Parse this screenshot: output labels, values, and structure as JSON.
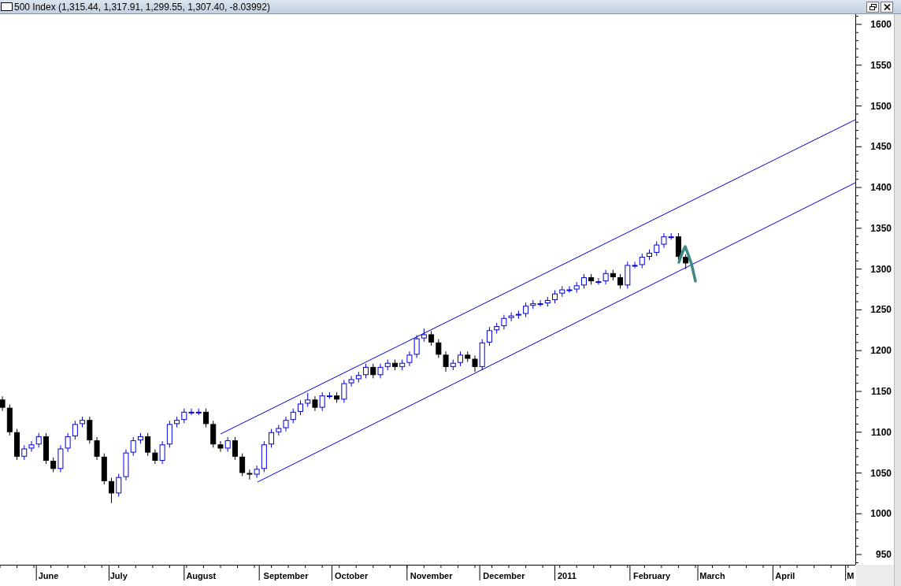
{
  "window": {
    "title": "500 Index (1,315.44, 1,317.91, 1,299.55, 1,307.40, -8.03992)"
  },
  "chart": {
    "chart_data": {
      "type": "candlestick",
      "x": [
        "2010-05-18",
        "2010-05-21",
        "2010-05-24",
        "2010-05-27",
        "2010-05-30",
        "2010-06-02",
        "2010-06-05",
        "2010-06-08",
        "2010-06-11",
        "2010-06-14",
        "2010-06-17",
        "2010-06-20",
        "2010-06-23",
        "2010-06-26",
        "2010-06-29",
        "2010-07-02",
        "2010-07-05",
        "2010-07-08",
        "2010-07-11",
        "2010-07-14",
        "2010-07-17",
        "2010-07-20",
        "2010-07-23",
        "2010-07-26",
        "2010-07-29",
        "2010-08-01",
        "2010-08-04",
        "2010-08-07",
        "2010-08-10",
        "2010-08-13",
        "2010-08-16",
        "2010-08-19",
        "2010-08-22",
        "2010-08-25",
        "2010-08-28",
        "2010-08-31",
        "2010-09-03",
        "2010-09-06",
        "2010-09-09",
        "2010-09-12",
        "2010-09-15",
        "2010-09-18",
        "2010-09-21",
        "2010-09-24",
        "2010-09-27",
        "2010-09-30",
        "2010-10-03",
        "2010-10-06",
        "2010-10-09",
        "2010-10-12",
        "2010-10-15",
        "2010-10-18",
        "2010-10-21",
        "2010-10-24",
        "2010-10-27",
        "2010-10-30",
        "2010-11-02",
        "2010-11-05",
        "2010-11-08",
        "2010-11-11",
        "2010-11-14",
        "2010-11-17",
        "2010-11-20",
        "2010-11-23",
        "2010-11-26",
        "2010-11-29",
        "2010-12-02",
        "2010-12-05",
        "2010-12-08",
        "2010-12-11",
        "2010-12-14",
        "2010-12-17",
        "2010-12-20",
        "2010-12-23",
        "2010-12-26",
        "2010-12-29",
        "2011-01-01",
        "2011-01-04",
        "2011-01-07",
        "2011-01-10",
        "2011-01-13",
        "2011-01-16",
        "2011-01-19",
        "2011-01-22",
        "2011-01-25",
        "2011-01-28",
        "2011-01-31",
        "2011-02-03",
        "2011-02-06",
        "2011-02-09",
        "2011-02-12",
        "2011-02-15",
        "2011-02-18",
        "2011-02-21",
        "2011-02-24"
      ],
      "ohlc": [
        [
          1140,
          1144,
          1126,
          1130
        ],
        [
          1130,
          1134,
          1096,
          1100
        ],
        [
          1100,
          1104,
          1066,
          1070
        ],
        [
          1070,
          1084,
          1066,
          1080
        ],
        [
          1080,
          1089,
          1076,
          1085
        ],
        [
          1085,
          1099,
          1081,
          1095
        ],
        [
          1095,
          1099,
          1061,
          1065
        ],
        [
          1065,
          1069,
          1051,
          1055
        ],
        [
          1055,
          1084,
          1051,
          1080
        ],
        [
          1080,
          1099,
          1076,
          1095
        ],
        [
          1095,
          1114,
          1091,
          1110
        ],
        [
          1110,
          1119,
          1106,
          1115
        ],
        [
          1115,
          1119,
          1086,
          1090
        ],
        [
          1090,
          1094,
          1066,
          1070
        ],
        [
          1070,
          1074,
          1036,
          1040
        ],
        [
          1040,
          1044,
          1013,
          1025
        ],
        [
          1025,
          1049,
          1021,
          1045
        ],
        [
          1045,
          1079,
          1041,
          1075
        ],
        [
          1075,
          1094,
          1071,
          1090
        ],
        [
          1090,
          1099,
          1086,
          1095
        ],
        [
          1095,
          1099,
          1071,
          1075
        ],
        [
          1075,
          1079,
          1061,
          1065
        ],
        [
          1065,
          1089,
          1061,
          1085
        ],
        [
          1085,
          1114,
          1081,
          1110
        ],
        [
          1110,
          1119,
          1106,
          1115
        ],
        [
          1115,
          1129,
          1111,
          1125
        ],
        [
          1125,
          1129,
          1121,
          1125
        ],
        [
          1125,
          1129,
          1121,
          1125
        ],
        [
          1125,
          1129,
          1106,
          1110
        ],
        [
          1110,
          1114,
          1081,
          1085
        ],
        [
          1085,
          1089,
          1076,
          1080
        ],
        [
          1080,
          1094,
          1076,
          1090
        ],
        [
          1090,
          1094,
          1066,
          1070
        ],
        [
          1070,
          1074,
          1046,
          1050
        ],
        [
          1050,
          1054,
          1042,
          1048
        ],
        [
          1048,
          1059,
          1044,
          1055
        ],
        [
          1055,
          1089,
          1051,
          1085
        ],
        [
          1085,
          1104,
          1081,
          1100
        ],
        [
          1100,
          1109,
          1096,
          1105
        ],
        [
          1105,
          1119,
          1101,
          1115
        ],
        [
          1115,
          1129,
          1111,
          1125
        ],
        [
          1125,
          1139,
          1121,
          1135
        ],
        [
          1135,
          1148,
          1131,
          1140
        ],
        [
          1140,
          1144,
          1126,
          1130
        ],
        [
          1130,
          1149,
          1126,
          1145
        ],
        [
          1145,
          1149,
          1141,
          1145
        ],
        [
          1145,
          1149,
          1136,
          1140
        ],
        [
          1140,
          1164,
          1136,
          1160
        ],
        [
          1160,
          1169,
          1156,
          1165
        ],
        [
          1165,
          1174,
          1161,
          1170
        ],
        [
          1170,
          1184,
          1166,
          1180
        ],
        [
          1180,
          1184,
          1166,
          1170
        ],
        [
          1170,
          1184,
          1166,
          1180
        ],
        [
          1180,
          1189,
          1176,
          1185
        ],
        [
          1185,
          1189,
          1176,
          1180
        ],
        [
          1180,
          1189,
          1176,
          1185
        ],
        [
          1185,
          1199,
          1181,
          1195
        ],
        [
          1195,
          1219,
          1191,
          1215
        ],
        [
          1215,
          1227,
          1211,
          1220
        ],
        [
          1220,
          1224,
          1206,
          1210
        ],
        [
          1210,
          1214,
          1191,
          1195
        ],
        [
          1195,
          1199,
          1174,
          1180
        ],
        [
          1180,
          1189,
          1176,
          1185
        ],
        [
          1185,
          1199,
          1181,
          1195
        ],
        [
          1195,
          1199,
          1186,
          1190
        ],
        [
          1190,
          1194,
          1174,
          1180
        ],
        [
          1180,
          1214,
          1176,
          1210
        ],
        [
          1210,
          1229,
          1206,
          1225
        ],
        [
          1225,
          1234,
          1221,
          1230
        ],
        [
          1230,
          1244,
          1226,
          1240
        ],
        [
          1240,
          1247,
          1236,
          1243
        ],
        [
          1243,
          1249,
          1239,
          1245
        ],
        [
          1245,
          1259,
          1241,
          1255
        ],
        [
          1255,
          1262,
          1251,
          1258
        ],
        [
          1258,
          1262,
          1254,
          1258
        ],
        [
          1258,
          1266,
          1254,
          1262
        ],
        [
          1262,
          1274,
          1258,
          1270
        ],
        [
          1270,
          1279,
          1266,
          1275
        ],
        [
          1275,
          1279,
          1271,
          1275
        ],
        [
          1275,
          1284,
          1271,
          1280
        ],
        [
          1280,
          1294,
          1276,
          1290
        ],
        [
          1290,
          1294,
          1281,
          1285
        ],
        [
          1285,
          1289,
          1281,
          1285
        ],
        [
          1285,
          1299,
          1281,
          1295
        ],
        [
          1295,
          1299,
          1286,
          1290
        ],
        [
          1290,
          1294,
          1276,
          1280
        ],
        [
          1280,
          1309,
          1276,
          1305
        ],
        [
          1305,
          1309,
          1301,
          1305
        ],
        [
          1305,
          1319,
          1301,
          1315
        ],
        [
          1315,
          1324,
          1311,
          1320
        ],
        [
          1320,
          1334,
          1316,
          1330
        ],
        [
          1330,
          1344,
          1326,
          1340
        ],
        [
          1340,
          1344,
          1336,
          1340
        ],
        [
          1340,
          1344,
          1311,
          1315
        ],
        [
          1315,
          1318,
          1300,
          1307
        ]
      ],
      "xlim": [
        "2010-05-17",
        "2011-05-05"
      ],
      "ylim": [
        937.5,
        1612.5
      ],
      "yticks": [
        950,
        1000,
        1050,
        1100,
        1150,
        1200,
        1250,
        1300,
        1350,
        1400,
        1450,
        1500,
        1550,
        1600
      ],
      "xticks": [
        {
          "value": "2010-06-06",
          "label": "June"
        },
        {
          "value": "2010-07-05",
          "label": "July"
        },
        {
          "value": "2010-08-08",
          "label": "August"
        },
        {
          "value": "2010-09-12",
          "label": "September"
        },
        {
          "value": "2010-10-09",
          "label": "October"
        },
        {
          "value": "2010-11-11",
          "label": "November"
        },
        {
          "value": "2010-12-11",
          "label": "December"
        },
        {
          "value": "2011-01-06",
          "label": "2011"
        },
        {
          "value": "2011-02-10",
          "label": "February"
        },
        {
          "value": "2011-03-07",
          "label": "March"
        },
        {
          "value": "2011-04-06",
          "label": "April"
        },
        {
          "value": "2011-05-03",
          "label": "M"
        }
      ]
    }
  }
}
